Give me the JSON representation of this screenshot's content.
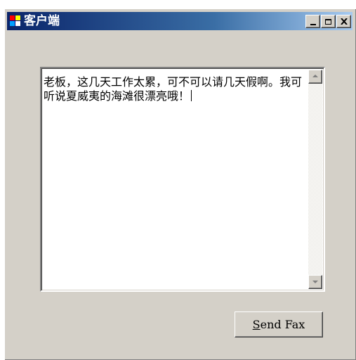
{
  "window": {
    "title": "客户端",
    "controls": {
      "minimize": "_",
      "maximize": "□",
      "close": "✕"
    }
  },
  "message": {
    "text": "老板，这几天工作太累，可不可以请几天假啊。我可听说夏威夷的海滩很漂亮哦！"
  },
  "send_button": {
    "mnemonic": "S",
    "rest": "end Fax"
  },
  "colors": {
    "titlebar_start": "#0a246a",
    "titlebar_end": "#a6caf0",
    "face": "#d4d0c8"
  }
}
